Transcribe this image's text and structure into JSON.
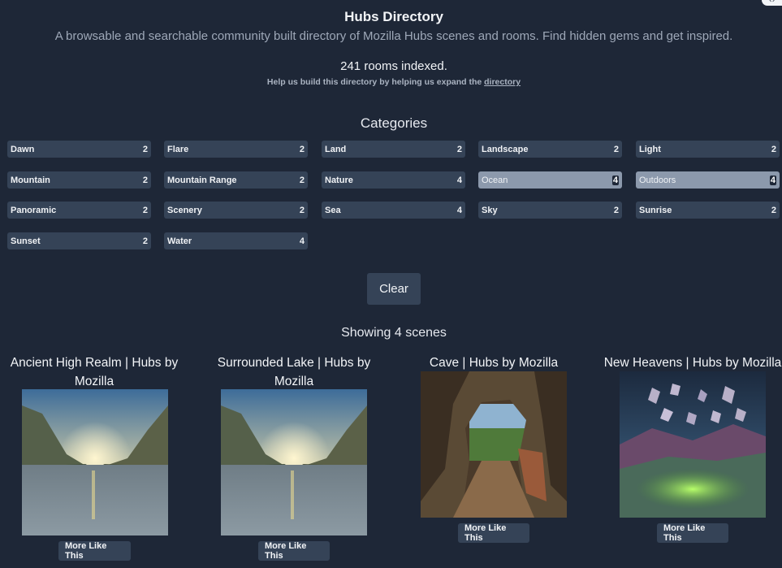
{
  "header": {
    "title": "Hubs Directory",
    "subtitle": "A browsable and searchable community built directory of Mozilla Hubs scenes and rooms. Find hidden gems and get inspired.",
    "rooms_indexed": "241 rooms indexed.",
    "help_text": "Help us build this directory by helping us expand the",
    "help_link": "directory"
  },
  "categories": {
    "heading": "Categories",
    "items": [
      {
        "label": "Dawn",
        "count": "2",
        "active": false
      },
      {
        "label": "Flare",
        "count": "2",
        "active": false
      },
      {
        "label": "Land",
        "count": "2",
        "active": false
      },
      {
        "label": "Landscape",
        "count": "2",
        "active": false
      },
      {
        "label": "Light",
        "count": "2",
        "active": false
      },
      {
        "label": "Mountain",
        "count": "2",
        "active": false
      },
      {
        "label": "Mountain Range",
        "count": "2",
        "active": false
      },
      {
        "label": "Nature",
        "count": "4",
        "active": false
      },
      {
        "label": "Ocean",
        "count": "4",
        "active": true
      },
      {
        "label": "Outdoors",
        "count": "4",
        "active": true
      },
      {
        "label": "Panoramic",
        "count": "2",
        "active": false
      },
      {
        "label": "Scenery",
        "count": "2",
        "active": false
      },
      {
        "label": "Sea",
        "count": "4",
        "active": false
      },
      {
        "label": "Sky",
        "count": "2",
        "active": false
      },
      {
        "label": "Sunrise",
        "count": "2",
        "active": false
      },
      {
        "label": "Sunset",
        "count": "2",
        "active": false
      },
      {
        "label": "Water",
        "count": "4",
        "active": false
      }
    ],
    "clear_label": "Clear"
  },
  "results": {
    "showing": "Showing 4 scenes",
    "scenes": [
      {
        "title_line1": "Ancient High Realm | Hubs by",
        "title_line2": "Mozilla",
        "button": "More Like This"
      },
      {
        "title_line1": "Surrounded Lake | Hubs by",
        "title_line2": "Mozilla",
        "button": "More Like This"
      },
      {
        "title_line1": "Cave | Hubs by Mozilla",
        "title_line2": "",
        "button": "More Like This"
      },
      {
        "title_line1": "New Heavens | Hubs by Mozilla",
        "title_line2": "",
        "button": "More Like This"
      }
    ]
  },
  "colors": {
    "background": "#1e2737",
    "chip": "#354357",
    "chip_active": "#8c99ac"
  }
}
